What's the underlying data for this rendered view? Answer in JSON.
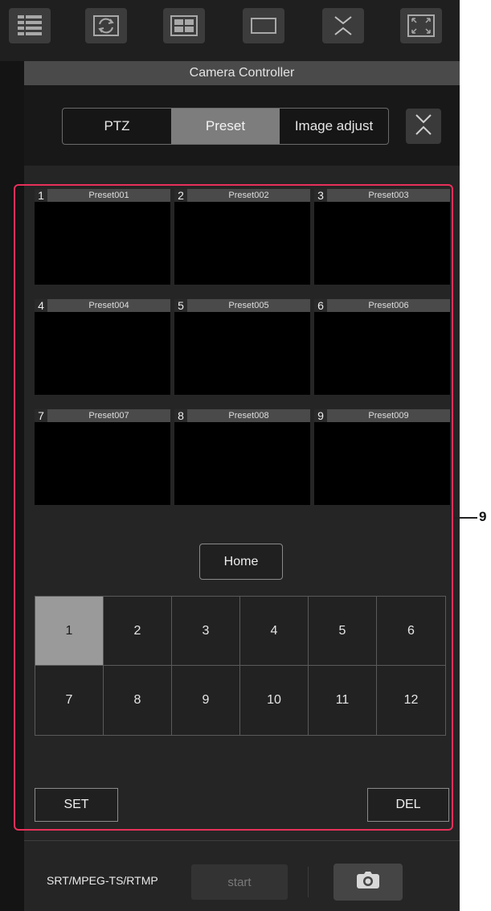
{
  "toolbar": {
    "icons": [
      "list-view-icon",
      "rotate-image-icon",
      "quad-screen-icon",
      "single-screen-icon",
      "collapse-icon",
      "fullscreen-icon"
    ]
  },
  "panel": {
    "title": "Camera Controller",
    "tabs": [
      {
        "label": "PTZ",
        "active": false
      },
      {
        "label": "Preset",
        "active": true
      },
      {
        "label": "Image adjust",
        "active": false
      }
    ]
  },
  "presets": [
    {
      "number": "1",
      "name": "Preset001"
    },
    {
      "number": "2",
      "name": "Preset002"
    },
    {
      "number": "3",
      "name": "Preset003"
    },
    {
      "number": "4",
      "name": "Preset004"
    },
    {
      "number": "5",
      "name": "Preset005"
    },
    {
      "number": "6",
      "name": "Preset006"
    },
    {
      "number": "7",
      "name": "Preset007"
    },
    {
      "number": "8",
      "name": "Preset008"
    },
    {
      "number": "9",
      "name": "Preset009"
    }
  ],
  "home_label": "Home",
  "number_buttons": [
    "1",
    "2",
    "3",
    "4",
    "5",
    "6",
    "7",
    "8",
    "9",
    "10",
    "11",
    "12"
  ],
  "selected_number": "1",
  "set_label": "SET",
  "del_label": "DEL",
  "callout_label": "9",
  "stream": {
    "label": "SRT/MPEG-TS/RTMP",
    "start_label": "start"
  },
  "colors": {
    "callout": "#e8305a",
    "active_tab": "#7d7d7d",
    "selected_number": "#9a9a9a"
  }
}
